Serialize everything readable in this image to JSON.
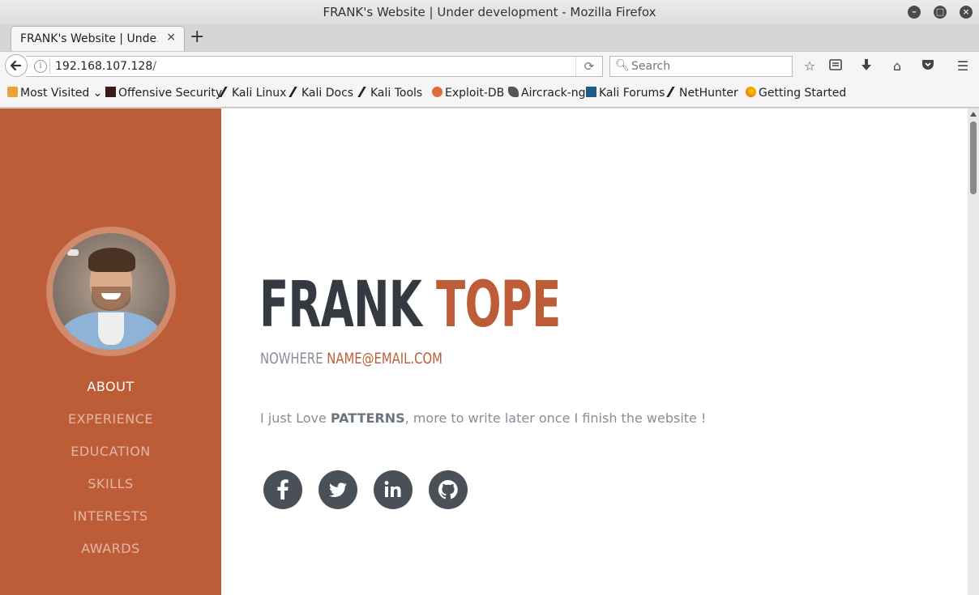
{
  "window": {
    "title": "FRANK's Website | Under development - Mozilla Firefox"
  },
  "tab": {
    "label": "FRANK's Website | Unde...",
    "close": "×",
    "new_tab": "+"
  },
  "navbar": {
    "url_host": "192.168.107.128",
    "url_path": "/",
    "search_placeholder": "Search"
  },
  "bookmarks": [
    {
      "label": "Most Visited",
      "icon": "folder-icon"
    },
    {
      "label": "Offensive Security",
      "icon": "offsec-icon"
    },
    {
      "label": "Kali Linux",
      "icon": "kali-icon"
    },
    {
      "label": "Kali Docs",
      "icon": "kali-icon"
    },
    {
      "label": "Kali Tools",
      "icon": "kali-icon"
    },
    {
      "label": "Exploit-DB",
      "icon": "exploitdb-icon"
    },
    {
      "label": "Aircrack-ng",
      "icon": "aircrack-icon"
    },
    {
      "label": "Kali Forums",
      "icon": "kali-forums-icon"
    },
    {
      "label": "NetHunter",
      "icon": "kali-icon"
    },
    {
      "label": "Getting Started",
      "icon": "firefox-icon"
    }
  ],
  "sidebar": {
    "nav": [
      "ABOUT",
      "EXPERIENCE",
      "EDUCATION",
      "SKILLS",
      "INTERESTS",
      "AWARDS"
    ],
    "active": "ABOUT"
  },
  "about": {
    "first_name": "FRANK",
    "last_name": "TOPE",
    "location": "NOWHERE",
    "email": "NAME@EMAIL.COM",
    "lead_before": "I just Love ",
    "lead_bold": "PATTERNS",
    "lead_after": ", more to write later once I finish the website !"
  },
  "social": [
    "facebook-icon",
    "twitter-icon",
    "linkedin-icon",
    "github-icon"
  ],
  "colors": {
    "accent": "#bd5d38",
    "dark": "#343a40",
    "muted": "#868e96",
    "social_bg": "#495057"
  }
}
